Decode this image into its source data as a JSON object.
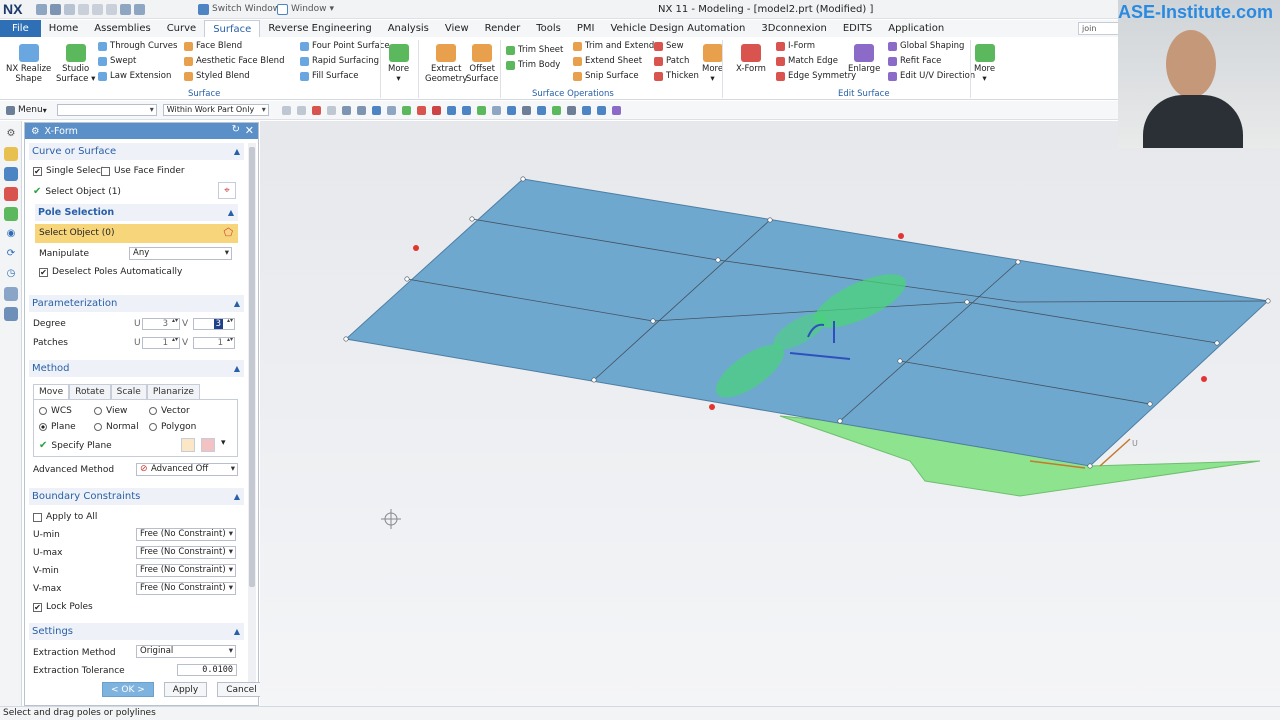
{
  "app": {
    "logo": "NX",
    "title": "NX 11 - Modeling - [model2.prt (Modified) ]"
  },
  "quick_access": {
    "switch_window": "Switch Window",
    "window": "Window"
  },
  "menubar": {
    "tabs": [
      "File",
      "Home",
      "Assemblies",
      "Curve",
      "Surface",
      "Reverse Engineering",
      "Analysis",
      "View",
      "Render",
      "Tools",
      "PMI",
      "Vehicle Design Automation",
      "3Dconnexion",
      "EDITS",
      "Application"
    ],
    "active": "Surface",
    "command_finder": "join"
  },
  "ribbon": {
    "big": [
      {
        "label1": "NX Realize",
        "label2": "Shape",
        "color": "#6aa7e0"
      },
      {
        "label1": "Studio",
        "label2": "Surface ▾",
        "color": "#5cb85c"
      },
      {
        "label1": "More",
        "label2": "▾",
        "color": "#5cb85c"
      },
      {
        "label1": "Extract",
        "label2": "Geometry",
        "color": "#e8a04c"
      },
      {
        "label1": "Offset",
        "label2": "Surface",
        "color": "#e8a04c"
      },
      {
        "label1": "More",
        "label2": "▾",
        "color": "#e8a04c"
      },
      {
        "label1": "X-Form",
        "label2": "",
        "color": "#d9534f"
      },
      {
        "label1": "Enlarge",
        "label2": "",
        "color": "#8b6bc7"
      },
      {
        "label1": "More",
        "label2": "▾",
        "color": "#5cb85c"
      }
    ],
    "col1": [
      "Through Curves",
      "Swept",
      "Law Extension"
    ],
    "col2": [
      "Face Blend",
      "Aesthetic Face Blend",
      "Styled Blend"
    ],
    "col3": [
      "Four Point Surface",
      "Rapid Surfacing",
      "Fill Surface"
    ],
    "col4": [
      "Trim Sheet",
      "Trim Body"
    ],
    "col5": [
      "Trim and Extend",
      "Extend Sheet",
      "Snip Surface"
    ],
    "col6": [
      "Sew",
      "Patch",
      "Thicken"
    ],
    "col7": [
      "I-Form",
      "Match Edge",
      "Edge Symmetry"
    ],
    "col8": [
      "Global Shaping",
      "Refit Face",
      "Edit U/V Direction"
    ],
    "groups": [
      "Surface",
      "Surface Operations",
      "Edit Surface"
    ]
  },
  "toolbar": {
    "menu": "Menu",
    "filter": "",
    "scope": "Within Work Part Only"
  },
  "dialog": {
    "title": "X-Form",
    "curve_or_surface": {
      "header": "Curve or Surface",
      "single_select": "Single Select",
      "use_face_finder": "Use Face Finder",
      "select_object": "Select Object (1)"
    },
    "pole_selection": {
      "header": "Pole Selection",
      "select_object": "Select Object (0)",
      "manipulate_label": "Manipulate",
      "manipulate_value": "Any",
      "deselect": "Deselect Poles Automatically"
    },
    "parameterization": {
      "header": "Parameterization",
      "degree": "Degree",
      "patches": "Patches",
      "u": "U",
      "v": "V",
      "degree_u": "3",
      "degree_v": "3",
      "patches_u": "1",
      "patches_v": "1"
    },
    "method": {
      "header": "Method",
      "tabs": [
        "Move",
        "Rotate",
        "Scale",
        "Planarize"
      ],
      "wcs": "WCS",
      "view": "View",
      "vector": "Vector",
      "plane": "Plane",
      "normal": "Normal",
      "polygon": "Polygon",
      "specify_plane": "Specify Plane",
      "advanced_method": "Advanced Method",
      "advanced_value": "Advanced Off"
    },
    "boundary": {
      "header": "Boundary Constraints",
      "apply_all": "Apply to All",
      "umin": "U-min",
      "umax": "U-max",
      "vmin": "V-min",
      "vmax": "V-max",
      "value": "Free (No Constraint)",
      "lock_poles": "Lock Poles"
    },
    "settings": {
      "header": "Settings",
      "extraction_method": "Extraction Method",
      "extraction_value": "Original",
      "extraction_tolerance": "Extraction Tolerance",
      "tolerance_value": "0.0100"
    },
    "buttons": {
      "ok": "< OK >",
      "apply": "Apply",
      "cancel": "Cancel"
    }
  },
  "viewport": {
    "label_u": "U",
    "surface_color": "#6fa8cf",
    "green_color": "#8ee38e"
  },
  "watermark": "ASE-Institute.com",
  "status": "Select and drag poles or polylines"
}
